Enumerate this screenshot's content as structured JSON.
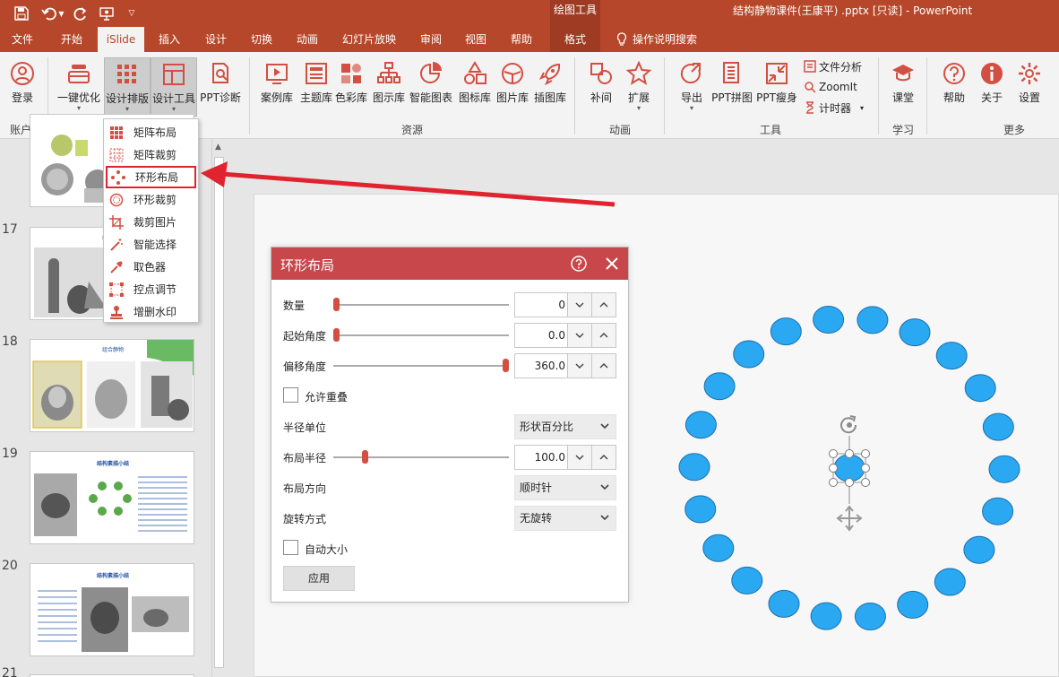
{
  "titlebar": {
    "drawing_tools": "绘图工具",
    "document_title": "结构静物课件(王康平) .pptx [只读] - PowerPoint"
  },
  "tabs": [
    {
      "label": "文件"
    },
    {
      "label": "开始"
    },
    {
      "label": "iSlide"
    },
    {
      "label": "插入"
    },
    {
      "label": "设计"
    },
    {
      "label": "切换"
    },
    {
      "label": "动画"
    },
    {
      "label": "幻灯片放映"
    },
    {
      "label": "审阅"
    },
    {
      "label": "视图"
    },
    {
      "label": "帮助"
    },
    {
      "label": "格式"
    }
  ],
  "tell_me": "操作说明搜索",
  "ribbon": {
    "buttons": {
      "login": "登录",
      "optimize": "一键优化",
      "design_layout": "设计排版",
      "design_tools": "设计工具",
      "diagnose": "PPT诊断",
      "case_lib": "案例库",
      "theme_lib": "主题库",
      "color_lib": "色彩库",
      "diagram_lib": "图示库",
      "smart_chart": "智能图表",
      "icon_lib": "图标库",
      "image_lib": "图片库",
      "illustration_lib": "插图库",
      "tween": "补间",
      "extend": "扩展",
      "export": "导出",
      "ppt_stitch": "PPT拼图",
      "ppt_slim": "PPT瘦身",
      "file_analysis": "文件分析",
      "zoomit": "ZoomIt",
      "timer": "计时器",
      "classroom": "课堂",
      "help": "帮助",
      "about": "关于",
      "settings": "设置"
    },
    "groups": {
      "account": "账户",
      "resources": "资源",
      "animation": "动画",
      "tools": "工具",
      "learn": "学习",
      "more": "更多"
    }
  },
  "menu": {
    "items": [
      {
        "label": "矩阵布局"
      },
      {
        "label": "矩阵裁剪"
      },
      {
        "label": "环形布局"
      },
      {
        "label": "环形裁剪"
      },
      {
        "label": "裁剪图片"
      },
      {
        "label": "智能选择"
      },
      {
        "label": "取色器"
      },
      {
        "label": "控点调节"
      },
      {
        "label": "增删水印"
      }
    ],
    "highlighted": "环形布局"
  },
  "slides": {
    "numbers": [
      "17",
      "18",
      "19",
      "20",
      "21"
    ],
    "thumb_titles": {
      "s17": "组合静物",
      "s18": "组合静物",
      "s19": "结构素描小结",
      "s20": "结构素描小结"
    }
  },
  "dialog": {
    "title": "环形布局",
    "fields": {
      "count_label": "数量",
      "count_value": "0",
      "count_fraction": 0.0,
      "start_angle_label": "起始角度",
      "start_angle_value": "0.0",
      "start_angle_fraction": 0.0,
      "offset_angle_label": "偏移角度",
      "offset_angle_value": "360.0",
      "offset_angle_fraction": 1.0,
      "allow_overlap_label": "允许重叠",
      "allow_overlap_checked": false,
      "radius_unit_label": "半径单位",
      "radius_unit_value": "形状百分比",
      "radius_label": "布局半径",
      "radius_value": "100.0",
      "radius_fraction": 0.17,
      "direction_label": "布局方向",
      "direction_value": "顺时针",
      "rotate_label": "旋转方式",
      "rotate_value": "无旋转",
      "autosize_label": "自动大小",
      "autosize_checked": false
    },
    "apply": "应用"
  },
  "colors": {
    "brand": "#b7472a",
    "dialog_header": "#c8474b",
    "slider_knob": "#d24f41",
    "ellipse_fill": "#2aa9f2",
    "ellipse_stroke": "#1b6fae",
    "arrow": "#e0242f"
  }
}
